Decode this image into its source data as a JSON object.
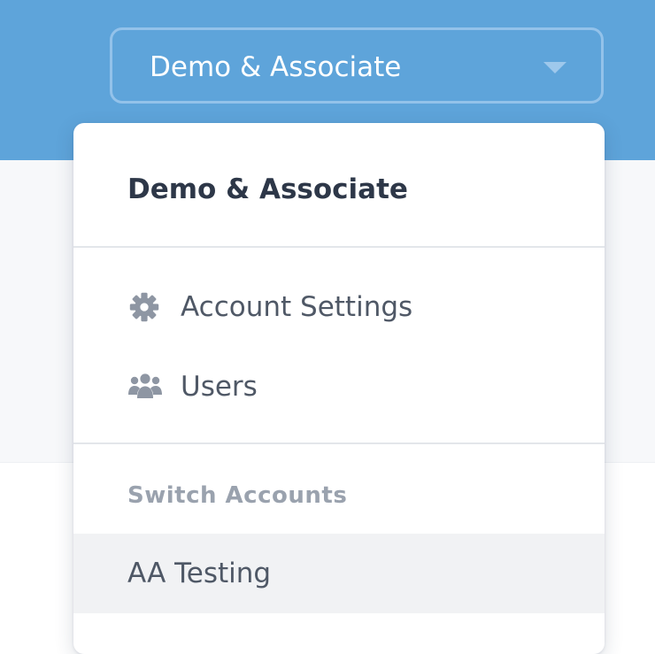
{
  "header": {
    "account_selector": {
      "value": "Demo & Associate"
    }
  },
  "dropdown": {
    "current_account": "Demo & Associate",
    "items": [
      {
        "label": "Account Settings",
        "icon": "gear-icon"
      },
      {
        "label": "Users",
        "icon": "users-icon"
      }
    ],
    "switch_heading": "Switch Accounts",
    "switch_items": [
      {
        "label": "AA Testing"
      }
    ]
  },
  "colors": {
    "header_background": "#5ea4da",
    "selector_border": "#93c2ea",
    "menu_text": "#4f5866",
    "heading_text": "#2d3748",
    "muted_text": "#9aa2ae",
    "hover_row": "#f1f2f4"
  }
}
